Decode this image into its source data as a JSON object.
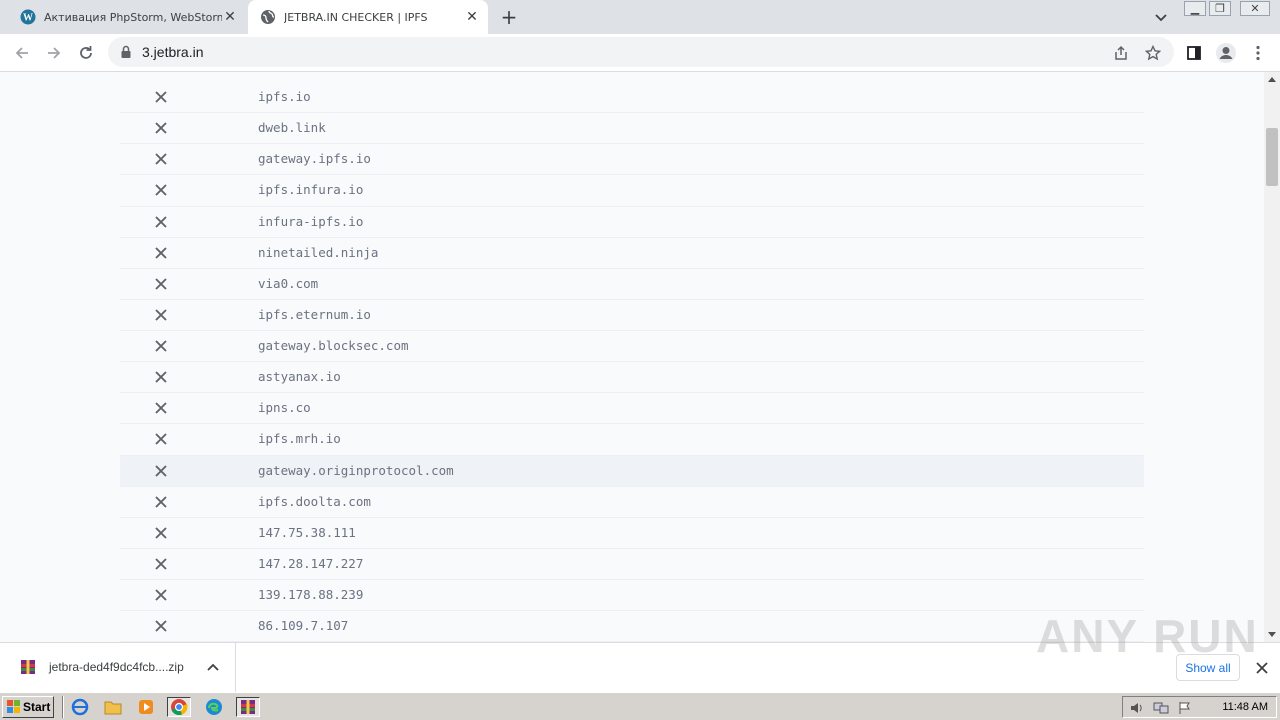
{
  "browser": {
    "tabs": [
      {
        "title": "Активация PhpStorm, WebStorm, IntelliJ",
        "icon": "wordpress-icon",
        "active": false
      },
      {
        "title": "JETBRA.IN CHECKER | IPFS",
        "icon": "globe-icon",
        "active": true
      }
    ],
    "address": "3.jetbra.in"
  },
  "gateways": [
    {
      "host": "ipfs.io",
      "status": "failed"
    },
    {
      "host": "dweb.link",
      "status": "failed"
    },
    {
      "host": "gateway.ipfs.io",
      "status": "failed"
    },
    {
      "host": "ipfs.infura.io",
      "status": "failed"
    },
    {
      "host": "infura-ipfs.io",
      "status": "failed"
    },
    {
      "host": "ninetailed.ninja",
      "status": "failed"
    },
    {
      "host": "via0.com",
      "status": "failed"
    },
    {
      "host": "ipfs.eternum.io",
      "status": "failed"
    },
    {
      "host": "gateway.blocksec.com",
      "status": "failed"
    },
    {
      "host": "astyanax.io",
      "status": "failed"
    },
    {
      "host": "ipns.co",
      "status": "failed"
    },
    {
      "host": "ipfs.mrh.io",
      "status": "failed"
    },
    {
      "host": "gateway.originprotocol.com",
      "status": "failed"
    },
    {
      "host": "ipfs.doolta.com",
      "status": "failed"
    },
    {
      "host": "147.75.38.111",
      "status": "failed"
    },
    {
      "host": "147.28.147.227",
      "status": "failed"
    },
    {
      "host": "139.178.88.239",
      "status": "failed"
    },
    {
      "host": "86.109.7.107",
      "status": "failed"
    }
  ],
  "downloads": {
    "file_name": "jetbra-ded4f9dc4fcb....zip",
    "show_all_label": "Show all"
  },
  "watermark": "ANY RUN",
  "taskbar": {
    "start_label": "Start",
    "clock": "11:48 AM"
  },
  "colors": {
    "accent": "#1a73e8",
    "fail_icon": "#5f6368",
    "page_bg": "#f8fafc"
  }
}
